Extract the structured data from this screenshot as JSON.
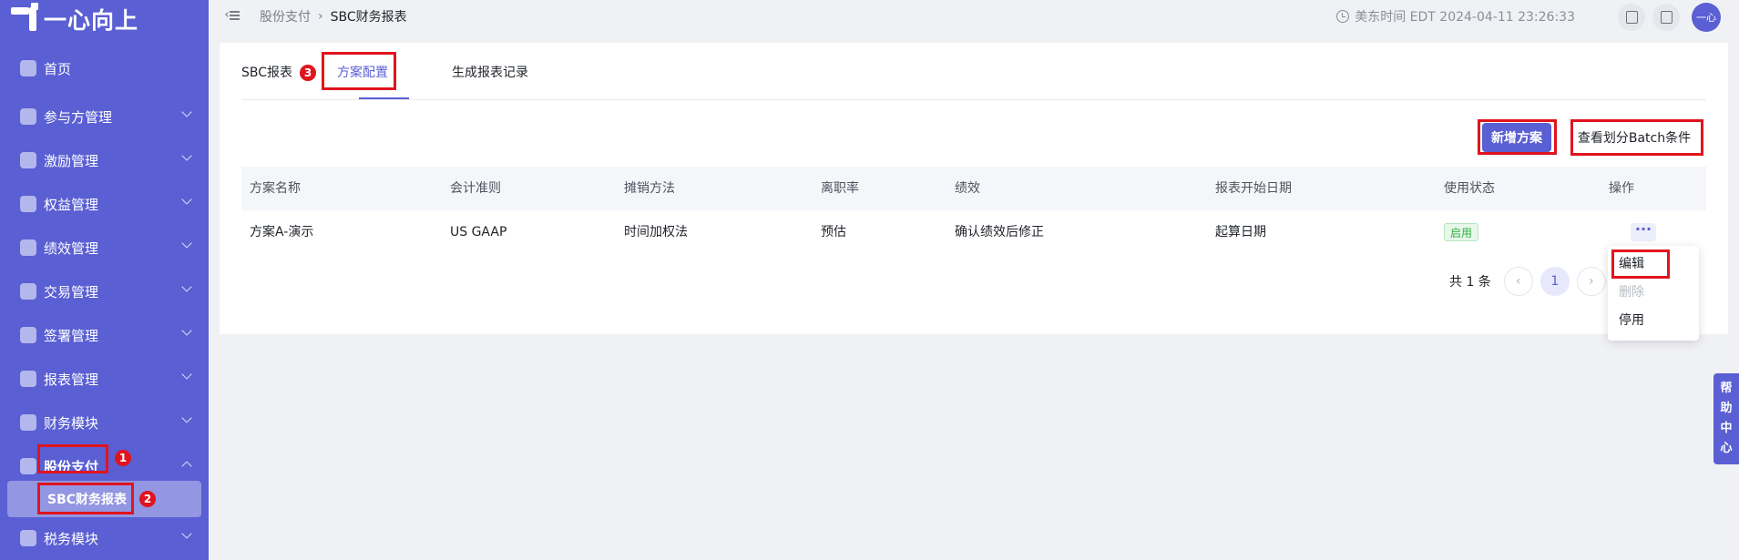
{
  "app": {
    "logo_text": "一心向上"
  },
  "sidebar": {
    "items": [
      {
        "label": "首页"
      },
      {
        "label": "参与方管理"
      },
      {
        "label": "激励管理"
      },
      {
        "label": "权益管理"
      },
      {
        "label": "绩效管理"
      },
      {
        "label": "交易管理"
      },
      {
        "label": "签署管理"
      },
      {
        "label": "报表管理"
      },
      {
        "label": "财务模块"
      },
      {
        "label": "股份支付"
      },
      {
        "label": "税务模块"
      }
    ],
    "sub_item": {
      "label": "SBC财务报表"
    }
  },
  "annotations": {
    "badge1": "1",
    "badge2": "2",
    "badge3": "3"
  },
  "topbar": {
    "breadcrumb": [
      "股份支付",
      "SBC财务报表"
    ],
    "clock_text": "美东时间 EDT 2024-04-11 23:26:33",
    "avatar_text": "一心"
  },
  "tabs": [
    {
      "label": "SBC报表"
    },
    {
      "label": "方案配置"
    },
    {
      "label": "生成报表记录"
    }
  ],
  "actions": {
    "add_plan": "新增方案",
    "view_batch": "查看划分Batch条件"
  },
  "table": {
    "headers": [
      "方案名称",
      "会计准则",
      "摊销方法",
      "离职率",
      "绩效",
      "报表开始日期",
      "使用状态",
      "操作"
    ],
    "rows": [
      {
        "name": "方案A-演示",
        "standard": "US GAAP",
        "method": "时间加权法",
        "turnover": "预估",
        "performance": "确认绩效后修正",
        "start_date": "起算日期",
        "status": "启用",
        "more": "···"
      }
    ]
  },
  "pagination": {
    "total_text": "共 1 条",
    "current_page": "1",
    "prev": "‹",
    "next": "›"
  },
  "dropdown": {
    "items": [
      {
        "label": "编辑"
      },
      {
        "label": "删除"
      },
      {
        "label": "停用"
      }
    ]
  },
  "help": {
    "chars": [
      "帮",
      "助",
      "中",
      "心"
    ]
  },
  "colors": {
    "primary": "#5a5fd3",
    "annotation_red": "#e0141e",
    "status_green": "#2fb344"
  }
}
